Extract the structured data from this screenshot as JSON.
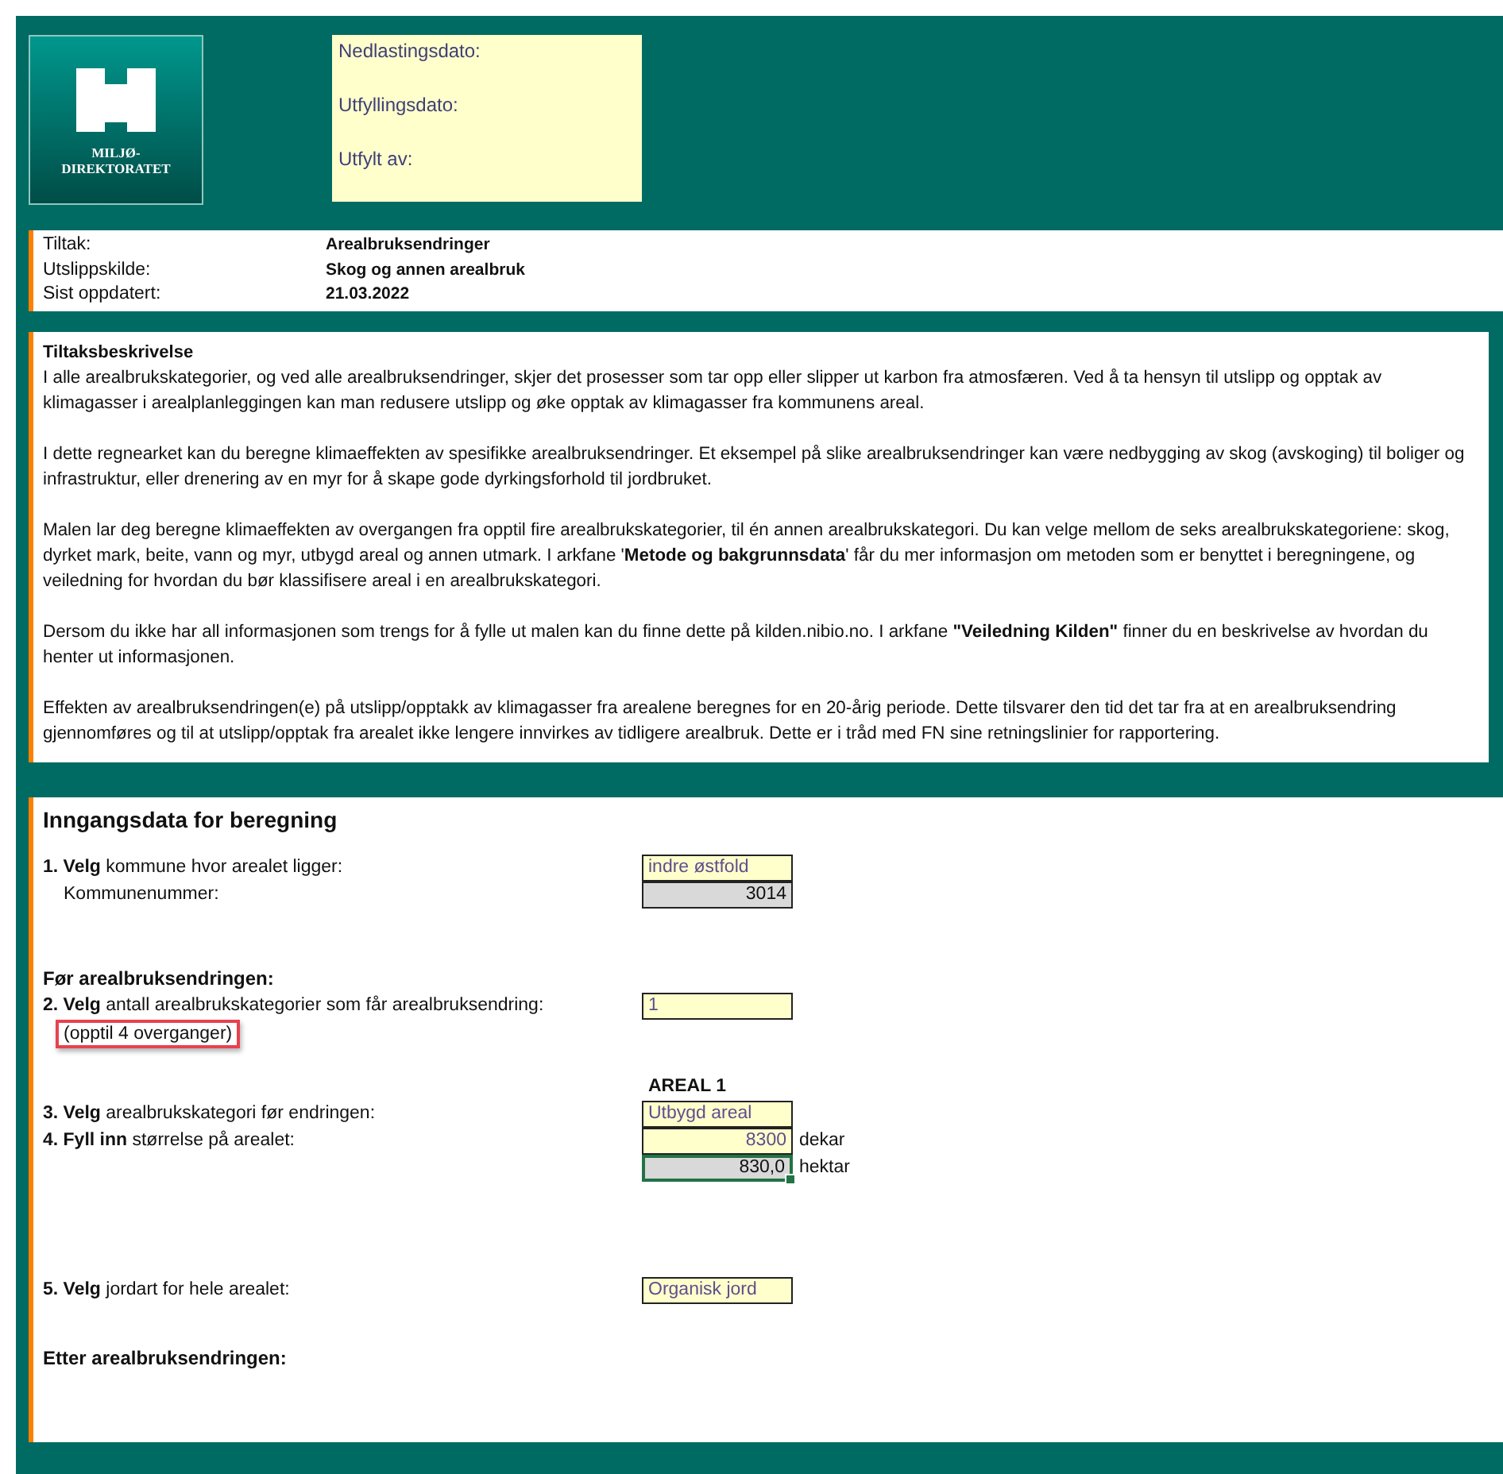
{
  "header": {
    "logo_text": [
      "MILJØ-",
      "DIREKTORATET"
    ],
    "info_box": [
      "Nedlastingsdato:",
      "Utfyllingsdato:",
      "Utfylt av:"
    ]
  },
  "meta": [
    {
      "label": "Tiltak:",
      "value": "Arealbruksendringer"
    },
    {
      "label": "Utslippskilde:",
      "value": "Skog og annen arealbruk"
    },
    {
      "label": "Sist oppdatert:",
      "value": "21.03.2022"
    }
  ],
  "description": {
    "title": "Tiltaksbeskrivelse",
    "paragraphs": [
      "I alle arealbrukskategorier, og ved alle arealbruksendringer, skjer det prosesser som tar opp eller slipper ut karbon fra atmosfæren. Ved å ta hensyn til utslipp og opptak av klimagasser i arealplanleggingen kan man redusere utslipp og øke opptak av klimagasser fra kommunens areal.",
      "I dette regnearket kan du beregne klimaeffekten av spesifikke arealbruksendringer. Et eksempel på slike arealbruksendringer kan være nedbygging av skog (avskoging) til boliger og infrastruktur, eller drenering av en myr for å skape gode dyrkingsforhold til jordbruket.",
      "Malen lar deg beregne klimaeffekten av overgangen fra opptil fire arealbrukskategorier, til én annen arealbrukskategori. Du kan velge mellom de seks arealbrukskategoriene: skog, dyrket mark, beite, vann og myr, utbygd areal og annen utmark. I arkfane '**Metode og bakgrunnsdata**' får du mer informasjon om metoden som er benyttet i beregningene, og veiledning for hvordan du bør klassifisere areal i en arealbrukskategori.",
      "Dersom du ikke har all informasjonen som trengs for å fylle ut malen kan du finne dette på kilden.nibio.no. I arkfane **\"Veiledning Kilden\"** finner du en beskrivelse av hvordan du henter ut informasjonen.",
      "Effekten av arealbruksendringen(e) på utslipp/opptakk av klimagasser fra arealene beregnes for en 20-årig periode. Dette tilsvarer den tid det tar fra at en arealbruksendring gjennomføres og til at utslipp/opptak fra arealet ikke lengere innvirkes av tidligere arealbruk. Dette er i tråd med FN sine retningslinier for rapportering."
    ]
  },
  "inputs": {
    "title": "Inngangsdata for beregning",
    "groups": [
      [
        {
          "kind": "field",
          "label": "**1. Velg** kommune hvor arealet ligger:",
          "cell": {
            "value": "indre østfold",
            "kind": "input",
            "selected": false
          }
        },
        {
          "kind": "subfield",
          "label": "Kommunenummer:",
          "cell": {
            "value": "3014",
            "kind": "computed",
            "selected": false
          }
        }
      ],
      [
        {
          "kind": "heading",
          "label": "Før arealbruksendringen:"
        },
        {
          "kind": "field",
          "label": "**2. Velg** antall arealbrukskategorier som får arealbruksendring:",
          "cell": {
            "value": "1",
            "kind": "input",
            "selected": false
          }
        },
        {
          "kind": "note",
          "label": "(opptil 4 overganger)",
          "highlighted": true
        }
      ],
      [
        {
          "kind": "column_header",
          "label": "AREAL 1"
        },
        {
          "kind": "field",
          "label": "**3. Velg** arealbrukskategori før endringen:",
          "cell": {
            "value": "Utbygd areal",
            "kind": "input",
            "selected": false
          }
        },
        {
          "kind": "field",
          "label": "**4. Fyll inn** størrelse på arealet:",
          "cell": {
            "value": "8300",
            "kind": "number",
            "selected": false
          },
          "unit": "dekar"
        },
        {
          "kind": "field",
          "cell": {
            "value": "830,0",
            "kind": "computed",
            "selected": true
          },
          "unit": "hektar"
        }
      ],
      [
        {
          "kind": "field",
          "label": "**5. Velg** jordart for hele arealet:",
          "cell": {
            "value": "Organisk jord",
            "kind": "input",
            "selected": false
          }
        }
      ],
      [
        {
          "kind": "heading",
          "label": "Etter arealbruksendringen:"
        }
      ]
    ]
  }
}
